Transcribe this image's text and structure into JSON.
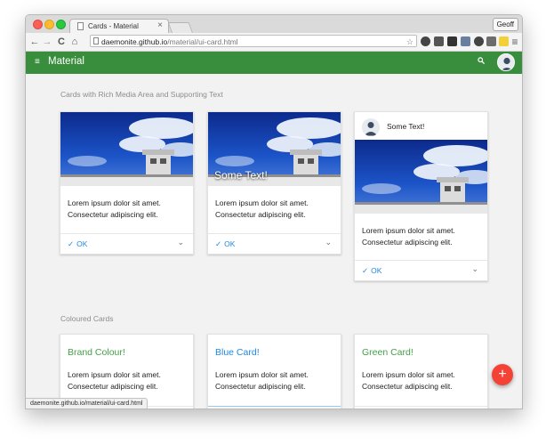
{
  "browser": {
    "tab_title": "Cards - Material",
    "tab_close": "×",
    "profile_name": "Geoff",
    "url_host": "daemonite.github.io",
    "url_path": "/material/ui-card.html",
    "status_url": "daemonite.github.io/material/ui-card.html",
    "nav": {
      "back": "←",
      "forward": "→",
      "reload": "C",
      "home": "⌂"
    },
    "star": "☆",
    "menu": "≡"
  },
  "app": {
    "title": "Material",
    "hamburger": "≡",
    "search_icon": "🔍"
  },
  "sections": {
    "rich_media": "Cards with Rich Media Area and Supporting Text",
    "coloured": "Coloured Cards"
  },
  "media_cards": [
    {
      "overlay": "",
      "text1": "Lorem ipsum dolor sit amet.",
      "text2": "Consectetur adipiscing elit.",
      "action": "OK",
      "check": "✓",
      "chevron": "⌄"
    },
    {
      "overlay": "Some Text!",
      "text1": "Lorem ipsum dolor sit amet.",
      "text2": "Consectetur adipiscing elit.",
      "action": "OK",
      "check": "✓",
      "chevron": "⌄"
    },
    {
      "header": "Some Text!",
      "text1": "Lorem ipsum dolor sit amet.",
      "text2": "Consectetur adipiscing elit.",
      "action": "OK",
      "check": "✓",
      "chevron": "⌄"
    }
  ],
  "colour_cards": [
    {
      "title": "Brand Colour!",
      "title_color": "#43a047",
      "text1": "Lorem ipsum dolor sit amet.",
      "text2": "Consectetur adipiscing elit.",
      "icons": [
        "+",
        "■",
        "✱"
      ]
    },
    {
      "title": "Blue Card!",
      "title_color": "#1e88e5",
      "text1": "Lorem ipsum dolor sit amet.",
      "text2": "Consectetur adipiscing elit.",
      "icons": [
        "+",
        "■",
        "✱"
      ]
    },
    {
      "title": "Green Card!",
      "title_color": "#43a047",
      "text1": "Lorem ipsum dolor sit amet.",
      "text2": "Consectetur adipiscing elit.",
      "icons": [
        "+",
        "■",
        "✱"
      ]
    }
  ],
  "fab_label": "+",
  "colors": {
    "appbar": "#388e3c",
    "accent_blue": "#1e88e5",
    "fab": "#f44336"
  },
  "icons": [
    "hamburger-icon",
    "search-icon",
    "avatar-icon",
    "check-icon",
    "chevron-down-icon",
    "add-icon",
    "delete-icon",
    "settings-icon",
    "star-icon"
  ]
}
